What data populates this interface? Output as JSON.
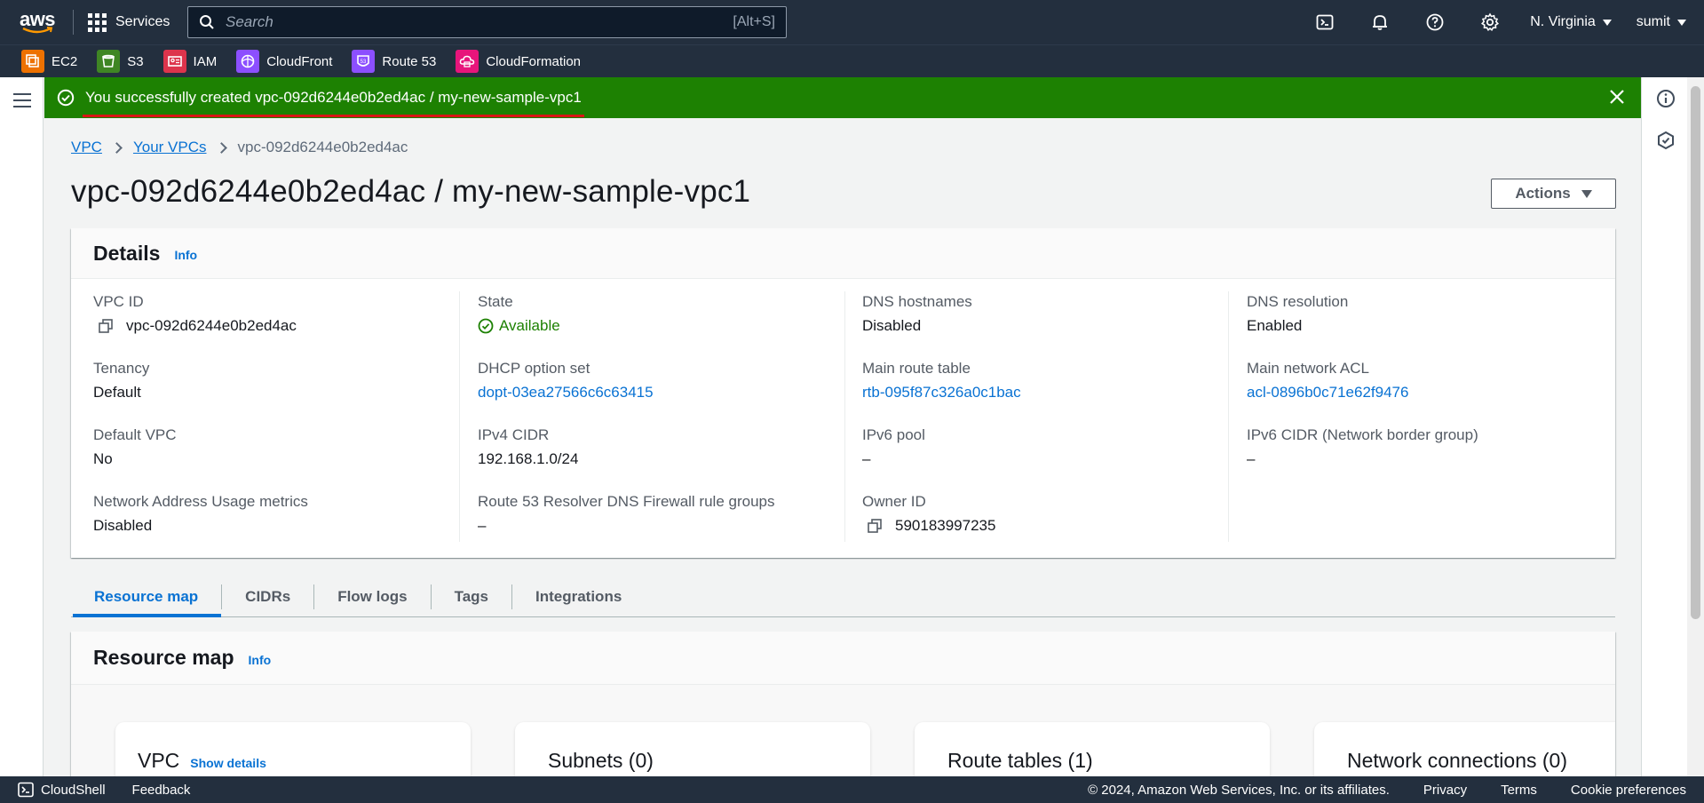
{
  "topnav": {
    "logo_text": "aws",
    "services_label": "Services",
    "search_placeholder": "Search",
    "search_shortcut": "[Alt+S]",
    "region": "N. Virginia",
    "user": "sumit"
  },
  "favorites": [
    {
      "label": "EC2",
      "color": "#ed7100",
      "icon": "ec2-icon"
    },
    {
      "label": "S3",
      "color": "#3f8624",
      "icon": "s3-icon"
    },
    {
      "label": "IAM",
      "color": "#dd344c",
      "icon": "iam-icon"
    },
    {
      "label": "CloudFront",
      "color": "#8c4fff",
      "icon": "cloudfront-icon"
    },
    {
      "label": "Route 53",
      "color": "#8c4fff",
      "icon": "route53-icon"
    },
    {
      "label": "CloudFormation",
      "color": "#e7157b",
      "icon": "cloudformation-icon"
    }
  ],
  "flash": {
    "message": "You successfully created vpc-092d6244e0b2ed4ac / my-new-sample-vpc1",
    "color": "#1d8102"
  },
  "breadcrumb": {
    "items": [
      "VPC",
      "Your VPCs"
    ],
    "current": "vpc-092d6244e0b2ed4ac"
  },
  "page": {
    "title": "vpc-092d6244e0b2ed4ac / my-new-sample-vpc1",
    "actions_label": "Actions"
  },
  "details": {
    "heading": "Details",
    "info": "Info",
    "col1": [
      {
        "label": "VPC ID",
        "value": "vpc-092d6244e0b2ed4ac"
      },
      {
        "label": "Tenancy",
        "value": "Default"
      },
      {
        "label": "Default VPC",
        "value": "No"
      },
      {
        "label": "Network Address Usage metrics",
        "value": "Disabled"
      }
    ],
    "col2": [
      {
        "label": "State",
        "value": "Available"
      },
      {
        "label": "DHCP option set",
        "value": "dopt-03ea27566c6c63415"
      },
      {
        "label": "IPv4 CIDR",
        "value": "192.168.1.0/24"
      },
      {
        "label": "Route 53 Resolver DNS Firewall rule groups",
        "value": "–"
      }
    ],
    "col3": [
      {
        "label": "DNS hostnames",
        "value": "Disabled"
      },
      {
        "label": "Main route table",
        "value": "rtb-095f87c326a0c1bac"
      },
      {
        "label": "IPv6 pool",
        "value": "–"
      },
      {
        "label": "Owner ID",
        "value": "590183997235"
      }
    ],
    "col4": [
      {
        "label": "DNS resolution",
        "value": "Enabled"
      },
      {
        "label": "Main network ACL",
        "value": "acl-0896b0c71e62f9476"
      },
      {
        "label": "IPv6 CIDR (Network border group)",
        "value": "–"
      }
    ]
  },
  "tabs": [
    "Resource map",
    "CIDRs",
    "Flow logs",
    "Tags",
    "Integrations"
  ],
  "resource_map": {
    "heading": "Resource map",
    "info": "Info",
    "cards": [
      {
        "title": "VPC",
        "link": "Show details"
      },
      {
        "title": "Subnets (0)"
      },
      {
        "title": "Route tables (1)"
      },
      {
        "title": "Network connections (0)"
      }
    ]
  },
  "footer": {
    "cloudshell": "CloudShell",
    "feedback": "Feedback",
    "copyright": "© 2024, Amazon Web Services, Inc. or its affiliates.",
    "privacy": "Privacy",
    "terms": "Terms",
    "cookie": "Cookie preferences"
  }
}
